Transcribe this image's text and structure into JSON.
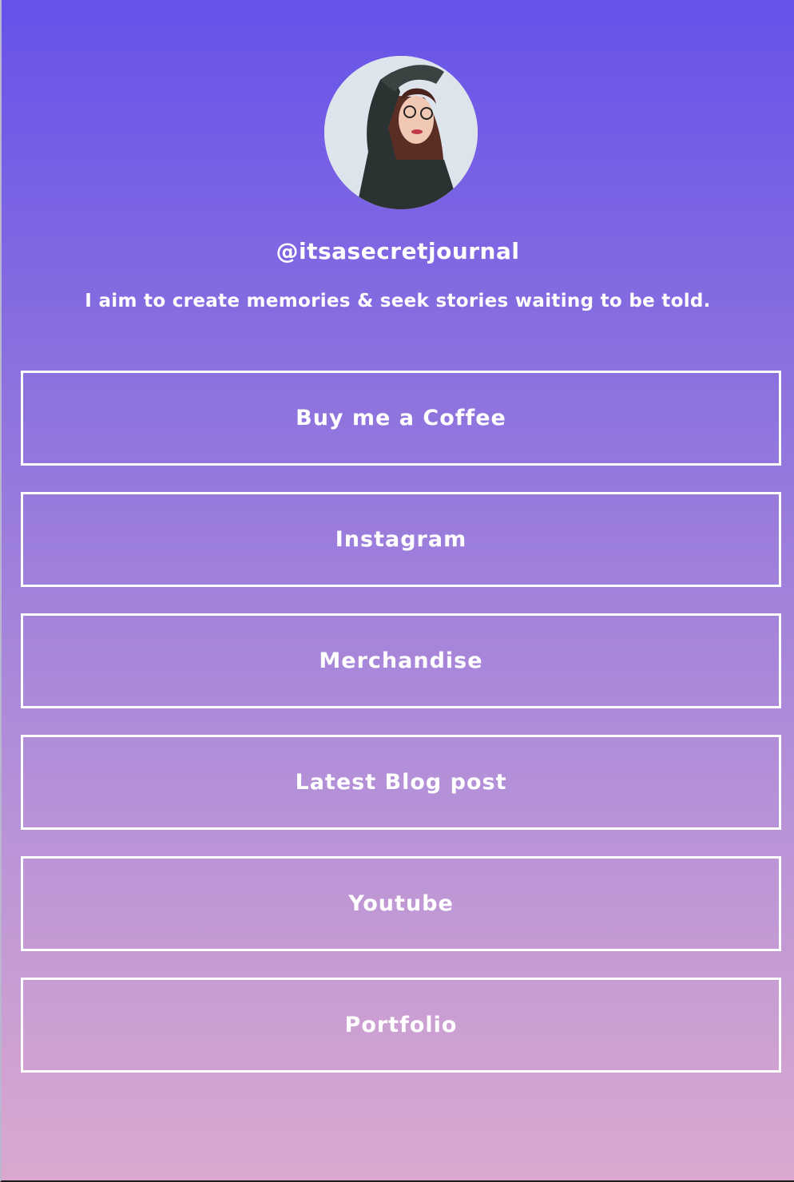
{
  "profile": {
    "handle": "@itsasecretjournal",
    "bio": "I aim to create memories & seek stories waiting to be told.",
    "avatar_icon": "profile-photo"
  },
  "links": [
    {
      "label": "Buy me a Coffee"
    },
    {
      "label": "Instagram"
    },
    {
      "label": "Merchandise"
    },
    {
      "label": "Latest Blog post"
    },
    {
      "label": "Youtube"
    },
    {
      "label": "Portfolio"
    }
  ],
  "colors": {
    "gradient_top": "#6652ea",
    "gradient_bottom": "#dba9cf",
    "button_border": "#ffffff",
    "text": "#ffffff"
  }
}
